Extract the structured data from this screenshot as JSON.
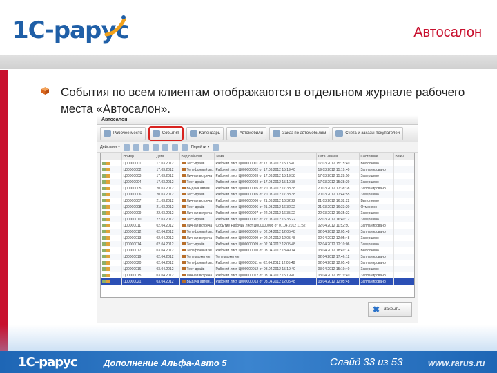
{
  "header": {
    "logo_text": "1С-рарус",
    "title": "Автосалон"
  },
  "bullet": {
    "text": "События по всем клиентам отображаются в отдельном журнале рабочего места «Автосалон»."
  },
  "window": {
    "title": "Автосалон",
    "tabs": [
      "Рабочее место",
      "События",
      "Календарь",
      "Автомобили",
      "Заказ по автомобилям",
      "Счета и заказы покупателей"
    ],
    "toolbar": {
      "actions_label": "Действия",
      "filter_label": "Перейти"
    },
    "columns": [
      "Номер",
      "Дата",
      "Вид события",
      "Тема",
      "Дата начала",
      "Состояние",
      "Важн."
    ],
    "rows": [
      [
        "Ц00000001",
        "17.03.2012",
        "Тест-драйв",
        "Рабочий лист Ц000000001 от 17.03.2012 15:15:40",
        "17.03.2012 15:15:40",
        "Выполнено"
      ],
      [
        "Ц00000002",
        "17.03.2012",
        "Телефонный зв...",
        "Рабочий лист Ц000000002 от 17.03.2012 15:19:40",
        "19.03.2012 15:19:40",
        "Запланировано"
      ],
      [
        "Ц00000003",
        "17.03.2012",
        "Личная встреча",
        "Рабочий лист Ц000000003 от 17.03.2012 15:19:38",
        "17.03.2012 15:28:50",
        "Завершено"
      ],
      [
        "Ц00000004",
        "17.03.2012",
        "Тест-драйв",
        "Рабочий лист Ц000000003 от 17.03.2012 15:19:38",
        "17.03.2012 15:38:29",
        "Завершено"
      ],
      [
        "Ц00000005",
        "20.03.2012",
        "Выдача автом...",
        "Рабочий лист Ц000000005 от 20.03.2012 17:38:38",
        "20.03.2012 17:38:38",
        "Запланировано"
      ],
      [
        "Ц00000006",
        "20.03.2012",
        "Тест-драйв",
        "Рабочий лист Ц000000005 от 20.03.2012 17:38:38",
        "20.03.2012 17:44:55",
        "Завершено"
      ],
      [
        "Ц00000007",
        "21.03.2012",
        "Личная встреча",
        "Рабочий лист Ц000000006 от 21.03.2012 16:32:22",
        "21.03.2012 16:32:22",
        "Выполнено"
      ],
      [
        "Ц00000008",
        "21.03.2012",
        "Тест-драйв",
        "Рабочий лист Ц000000006 от 21.03.2012 16:32:22",
        "21.03.2012 16:33:20",
        "Отменено"
      ],
      [
        "Ц00000009",
        "22.03.2012",
        "Личная встреча",
        "Рабочий лист Ц000000007 от 22.03.2012 16:35:22",
        "22.03.2012 16:35:22",
        "Завершено"
      ],
      [
        "Ц00000010",
        "22.03.2012",
        "Тест-драйв",
        "Рабочий лист Ц000000007 от 22.03.2012 16:35:22",
        "22.03.2012 16:40:12",
        "Завершено"
      ],
      [
        "Ц00000011",
        "02.04.2012",
        "Личная встреча",
        "Событие Рабочий лист Ц000000008 от 01.04.2012 11:52",
        "02.04.2012 11:52:50",
        "Запланировано"
      ],
      [
        "Ц00000012",
        "02.04.2012",
        "Телефонный зв...",
        "Рабочий лист Ц000000009 от 02.04.2012 12:05:48",
        "02.04.2012 12:05:48",
        "Запланировано"
      ],
      [
        "Ц00000013",
        "02.04.2012",
        "Личная встреча",
        "Рабочий лист Ц000000009 от 02.04.2012 12:05:48",
        "02.04.2012 12:05:48",
        "Завершено"
      ],
      [
        "Ц00000014",
        "02.04.2012",
        "Тест-драйв",
        "Рабочий лист Ц000000009 от 02.04.2012 12:05:48",
        "02.04.2012 12:10:06",
        "Завершено"
      ],
      [
        "Ц00000017",
        "03.04.2012",
        "Телефонный зв...",
        "Рабочий лист Ц000000010 от 03.04.2012 18:49:14",
        "03.04.2012 18:49:14",
        "Выполнено"
      ],
      [
        "Ц00000019",
        "02.04.2012",
        "Телемаркетинг",
        "Телемаркетинг",
        "02.04.2012 17:46:12",
        "Запланировано"
      ],
      [
        "Ц00000020",
        "02.04.2012",
        "Телефонный зв...",
        "Рабочий лист Ц000000011 от 02.04.2012 12:05:48",
        "02.04.2012 12:05:48",
        "Запланировано"
      ],
      [
        "Ц00000016",
        "03.04.2012",
        "Тест-драйв",
        "Рабочий лист Ц000000012 от 03.04.2012 15:19:40",
        "03.04.2012 15:19:40",
        "Завершено"
      ],
      [
        "Ц00000015",
        "03.04.2012",
        "Личная встреча",
        "Рабочий лист Ц000000012 от 03.04.2012 15:19:40",
        "03.04.2012 15:19:40",
        "Запланировано"
      ],
      [
        "Ц00000021",
        "03.04.2012",
        "Выдача автом...",
        "Рабочий лист Ц000000013 от 03.04.2012 12:05:48",
        "03.04.2012 12:05:48",
        "Запланировано"
      ]
    ],
    "close_label": "Закрыть"
  },
  "footer": {
    "logo_text": "1С-рарус",
    "product": "Дополнение Альфа-Авто 5",
    "slide": "Слайд 33 из 53",
    "url": "www.rarus.ru"
  },
  "colors": {
    "brand_red": "#c8102e",
    "brand_blue": "#1f5fa7",
    "tab_highlight": "#d8231f",
    "selected_row": "#2b4fb5"
  }
}
